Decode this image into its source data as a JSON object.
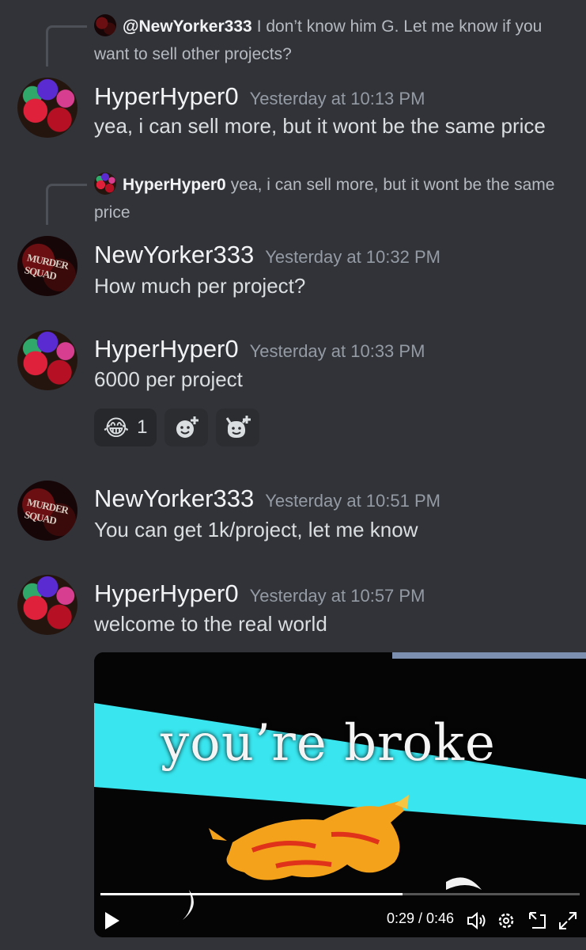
{
  "messages": [
    {
      "reply": {
        "author": "@NewYorker333",
        "text": "I don’t know him G. Let me know if you want to sell other projects?"
      },
      "author": "HyperHyper0",
      "time": "Yesterday at 10:13 PM",
      "text": "yea, i can sell more, but it wont be the same price"
    },
    {
      "reply": {
        "author": "HyperHyper0",
        "text": "yea, i can sell more, but it wont be the same price"
      },
      "author": "NewYorker333",
      "time": "Yesterday at 10:32 PM",
      "text": "How much per project?"
    },
    {
      "author": "HyperHyper0",
      "time": "Yesterday at 10:33 PM",
      "text": "6000 per project",
      "reactions": [
        {
          "emoji": "😂",
          "count": "1"
        }
      ]
    },
    {
      "author": "NewYorker333",
      "time": "Yesterday at 10:51 PM",
      "text": "You can get 1k/project, let me know"
    },
    {
      "author": "HyperHyper0",
      "time": "Yesterday at 10:57 PM",
      "text": "welcome to the real world"
    }
  ],
  "avatar_text": "MURDER SQUAD",
  "video": {
    "caption": "you’re broke",
    "time": "0:29 / 0:46",
    "progress": 0.63
  },
  "icons": {
    "add_reaction": "add-reaction-icon",
    "add_super_reaction": "add-super-reaction-icon",
    "play": "play-icon",
    "volume": "volume-icon",
    "settings": "gear-icon",
    "pip": "picture-in-picture-icon",
    "fullscreen": "fullscreen-icon"
  },
  "colors": {
    "background": "#313338",
    "username": "#f2f3f5",
    "timestamp": "#949ba4",
    "text": "#dbdee1",
    "reaction_bg": "#2b2d31",
    "video_cyan": "#39e6ef",
    "video_cat": "#f4a21c"
  }
}
